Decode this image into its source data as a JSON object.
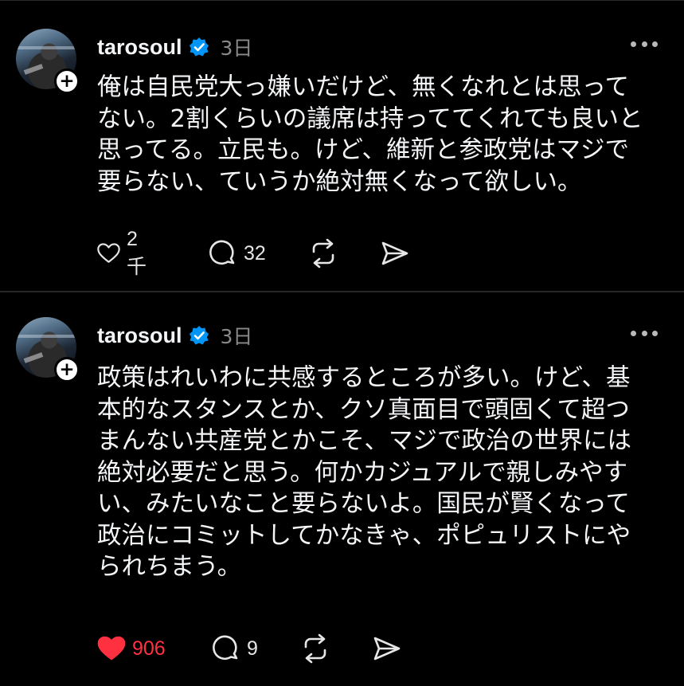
{
  "posts": [
    {
      "username": "tarosoul",
      "time": "3日",
      "text": "俺は自民党大っ嫌いだけど、無くなれとは思って\nない。2割くらいの議席は持っててくれても良いと\n思ってる。立民も。けど、維新と参政党はマジで\n要らない、ていうか絶対無くなって欲しい。",
      "likes": "2千",
      "liked": false,
      "replies": "32",
      "follow_icon": "plus-icon"
    },
    {
      "username": "tarosoul",
      "time": "3日",
      "text": "政策はれいわに共感するところが多い。けど、基\n本的なスタンスとか、クソ真面目で頭固くて超つ\nまんない共産党とかこそ、マジで政治の世界には\n絶対必要だと思う。何かカジュアルで親しみやす\nい、みたいなこと要らないよ。国民が賢くなって\n政治にコミットしてかなきゃ、ポピュリストにや\nられちまう。",
      "likes": "906",
      "liked": true,
      "replies": "9",
      "follow_icon": "plus-icon"
    }
  ],
  "colors": {
    "background": "#000000",
    "text": "#f3f5f7",
    "muted": "#8a8a8a",
    "liked": "#ff3040",
    "verified": "#0095f6"
  },
  "icons": [
    "heart-icon",
    "comment-icon",
    "repost-icon",
    "share-icon",
    "verified-badge-icon",
    "more-options-icon"
  ]
}
